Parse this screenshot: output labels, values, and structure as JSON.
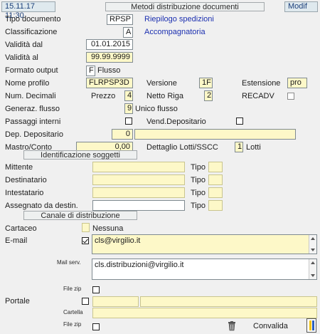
{
  "header": {
    "datetime": "15.11.17 11:30",
    "title": "Metodi distribuzione documenti",
    "mode": "Modif"
  },
  "fields": {
    "tipo_documento": {
      "label": "Tipo documento",
      "value": "RPSP",
      "desc": "Riepilogo spedizioni"
    },
    "classificazione": {
      "label": "Classificazione",
      "value": "A",
      "desc": "Accompagnatoria"
    },
    "validita_dal": {
      "label": "Validità dal",
      "value": "01.01.2015"
    },
    "validita_al": {
      "label": "Validità  al",
      "value": "99.99.9999"
    },
    "formato_output": {
      "label": "Formato output",
      "value": "F",
      "desc": "Flusso"
    },
    "nome_profilo": {
      "label": "Nome profilo",
      "value": "FLRPSP3D"
    },
    "versione": {
      "label": "Versione",
      "value": "1F"
    },
    "estensione": {
      "label": "Estensione",
      "value": "pro"
    },
    "num_decimali": {
      "label": "Num. Decimali"
    },
    "prezzo": {
      "label": "Prezzo",
      "value": "4"
    },
    "netto_riga": {
      "label": "Netto Riga",
      "value": "2"
    },
    "recadv": {
      "label": "RECADV"
    },
    "generaz_flusso": {
      "label": "Generaz. flusso",
      "value": "9",
      "desc": "Unico flusso"
    },
    "passaggi_interni": {
      "label": "Passaggi interni"
    },
    "vend_depositario": {
      "label": "Vend.Depositario"
    },
    "dep_depositario": {
      "label": "Dep. Depositario",
      "value": "0",
      "desc": ""
    },
    "mastro_conto": {
      "label": "Mastro/Conto",
      "value": "0,00"
    },
    "dettaglio_lotti": {
      "label": "Dettaglio Lotti/SSCC",
      "value": "1",
      "desc": "Lotti"
    }
  },
  "sections": {
    "identificazione": "Identificazione soggetti",
    "canale": "Canale di distribuzione"
  },
  "soggetti": [
    {
      "label": "Mittente",
      "tipo_label": "Tipo",
      "value": "",
      "tipo": ""
    },
    {
      "label": "Destinatario",
      "tipo_label": "Tipo",
      "value": "",
      "tipo": ""
    },
    {
      "label": "Intestatario",
      "tipo_label": "Tipo",
      "value": "",
      "tipo": ""
    },
    {
      "label": "Assegnato da destin.",
      "tipo_label": "Tipo",
      "value": "",
      "tipo": ""
    }
  ],
  "canale": {
    "cartaceo": {
      "label": "Cartaceo",
      "desc": "Nessuna"
    },
    "email": {
      "label": "E-mail",
      "value": "cls@virgilio.it",
      "checked": true
    },
    "mail_serv": {
      "label": "Mail serv.",
      "value": "cls.distribuzioni@virgilio.it"
    },
    "file_zip_1": {
      "label": "File zip"
    },
    "portale": {
      "label": "Portale"
    },
    "cartella": {
      "label": "Cartella"
    },
    "file_zip_2": {
      "label": "File zip"
    }
  },
  "footer": {
    "convalida_label": "Convalida"
  }
}
